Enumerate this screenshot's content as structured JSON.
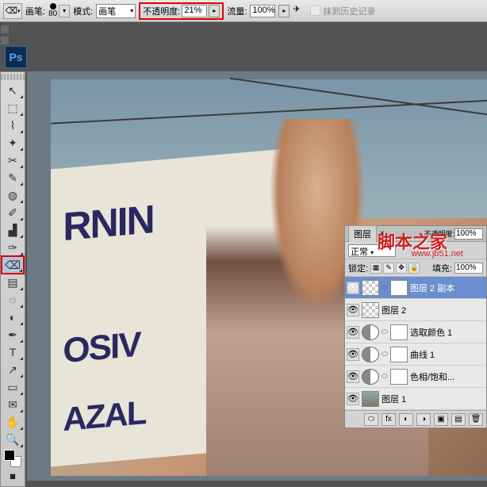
{
  "options_bar": {
    "brush_label": "画笔:",
    "brush_size": "80",
    "mode_label": "模式:",
    "mode_value": "画笔",
    "opacity_label": "不透明度:",
    "opacity_value": "21%",
    "flow_label": "流量:",
    "flow_value": "100%",
    "erase_history_label": "抹到历史记录"
  },
  "app_icon": "Ps",
  "tools": [
    {
      "name": "move-tool",
      "glyph": "↖"
    },
    {
      "name": "marquee-tool",
      "glyph": "⬚"
    },
    {
      "name": "lasso-tool",
      "glyph": "⌇"
    },
    {
      "name": "magic-wand-tool",
      "glyph": "✦"
    },
    {
      "name": "crop-tool",
      "glyph": "✂"
    },
    {
      "name": "eyedropper-tool",
      "glyph": "✎"
    },
    {
      "name": "healing-brush-tool",
      "glyph": "◍"
    },
    {
      "name": "brush-tool",
      "glyph": "✐"
    },
    {
      "name": "clone-stamp-tool",
      "glyph": "▟"
    },
    {
      "name": "history-brush-tool",
      "glyph": "✑"
    },
    {
      "name": "eraser-tool",
      "glyph": "⌫",
      "highlighted": true,
      "selected": true
    },
    {
      "name": "gradient-tool",
      "glyph": "▤"
    },
    {
      "name": "blur-tool",
      "glyph": "◌"
    },
    {
      "name": "dodge-tool",
      "glyph": "◐"
    },
    {
      "name": "pen-tool",
      "glyph": "✒"
    },
    {
      "name": "type-tool",
      "glyph": "T"
    },
    {
      "name": "path-selection-tool",
      "glyph": "↗"
    },
    {
      "name": "shape-tool",
      "glyph": "▭"
    },
    {
      "name": "notes-tool",
      "glyph": "✉"
    },
    {
      "name": "hand-tool",
      "glyph": "✋"
    },
    {
      "name": "zoom-tool",
      "glyph": "🔍"
    }
  ],
  "billboard": {
    "line1": "RNIN",
    "line2": "OSIV",
    "line3": "AZAL"
  },
  "watermark": {
    "main": "脚本之家",
    "sub": "www.jb51.net"
  },
  "layers_panel": {
    "tab_label": "图层",
    "opacity_mini_label": "不透明度:",
    "opacity_mini_value": "100%",
    "blend_mode": "正常",
    "lock_label": "锁定:",
    "fill_label": "填充:",
    "fill_value": "100%",
    "layers": [
      {
        "name": "图层 2 副本",
        "visible": true,
        "selected": true,
        "thumb": "checker",
        "has_mask": true
      },
      {
        "name": "图层 2",
        "visible": true,
        "thumb": "checker"
      },
      {
        "name": "选取颜色 1",
        "visible": true,
        "thumb": "adj",
        "has_mask": true
      },
      {
        "name": "曲线 1",
        "visible": true,
        "thumb": "adj",
        "has_mask": true
      },
      {
        "name": "色相/饱和...",
        "visible": true,
        "thumb": "adj",
        "has_mask": true
      },
      {
        "name": "图层 1",
        "visible": true,
        "thumb": "image"
      }
    ]
  }
}
